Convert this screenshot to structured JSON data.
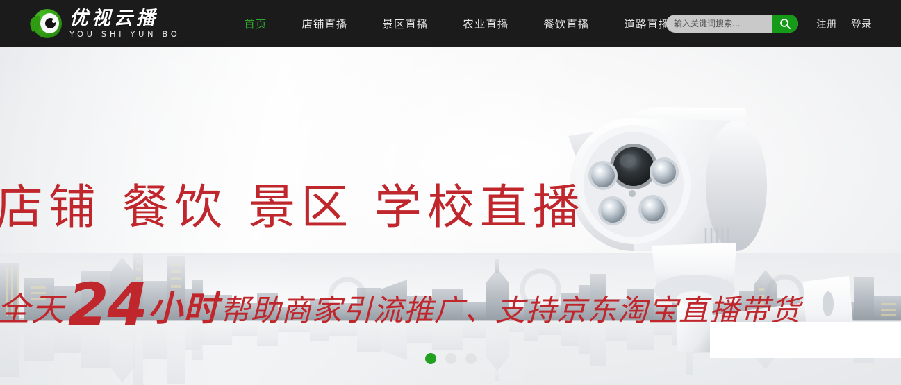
{
  "header": {
    "logo": {
      "cn": "优视云播",
      "en": "YOU SHI YUN BO",
      "icon": "eye-logo-icon"
    },
    "nav": [
      {
        "label": "首页",
        "active": true
      },
      {
        "label": "店铺直播",
        "active": false
      },
      {
        "label": "景区直播",
        "active": false
      },
      {
        "label": "农业直播",
        "active": false
      },
      {
        "label": "餐饮直播",
        "active": false
      },
      {
        "label": "道路直播",
        "active": false
      }
    ],
    "search": {
      "placeholder": "输入关键词搜索...",
      "value": "",
      "button_icon": "search-icon"
    },
    "auth": {
      "register": "注册",
      "login": "登录"
    },
    "background": "#1b1b1b",
    "accent": "#169b18",
    "active_nav_color": "#2ea62e"
  },
  "hero": {
    "headline": "店铺  餐饮  景区  学校直播",
    "subline": {
      "prefix": "全天",
      "number": "24",
      "unit": "小时",
      "suffix": "帮助商家引流推广、支持京东淘宝直播带货"
    },
    "image": "cctv-camera-image",
    "skyline": "city-skyline-silhouette",
    "red": "#c0272d",
    "carousel": {
      "dots": 3,
      "active_index": 0,
      "active_color": "#22a01f",
      "inactive_color": "#e3e3e3"
    }
  }
}
